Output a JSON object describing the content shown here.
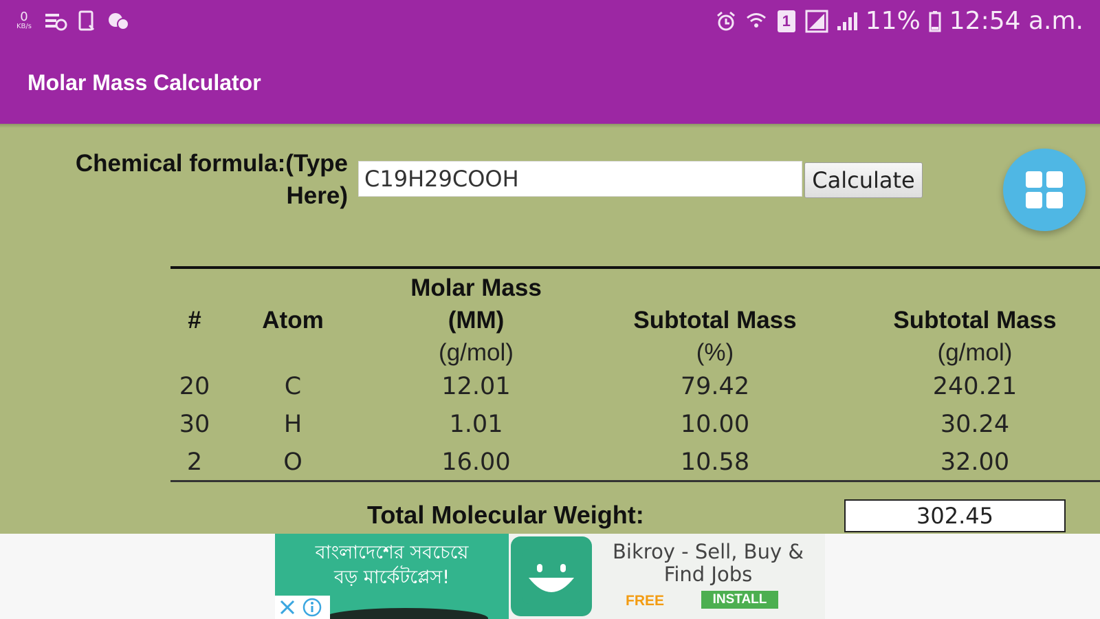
{
  "status_bar": {
    "battery": "11%",
    "time": "12:54 a.m.",
    "speed_value": "0",
    "speed_unit": "KB/s",
    "sim_label": "1"
  },
  "app_bar": {
    "title": "Molar Mass Calculator"
  },
  "form": {
    "label_line1": "Chemical formula:(Type",
    "label_line2": "Here)",
    "value": "C19H29COOH",
    "calculate_label": "Calculate"
  },
  "table": {
    "headers": {
      "count": "#",
      "atom": "Atom",
      "molar_mass_line1": "Molar Mass",
      "molar_mass_line2": "(MM)",
      "molar_mass_unit": "(g/mol)",
      "subtotal_pct": "Subtotal Mass",
      "subtotal_pct_unit": "(%)",
      "subtotal_gmol": "Subtotal Mass",
      "subtotal_gmol_unit": "(g/mol)"
    },
    "rows": [
      {
        "count": "20",
        "atom": "C",
        "mm": "12.01",
        "pct": "79.42",
        "gmol": "240.21"
      },
      {
        "count": "30",
        "atom": "H",
        "mm": "1.01",
        "pct": "10.00",
        "gmol": "30.24"
      },
      {
        "count": "2",
        "atom": "O",
        "mm": "16.00",
        "pct": "10.58",
        "gmol": "32.00"
      }
    ],
    "total_label": "Total Molecular Weight:",
    "total_value": "302.45"
  },
  "ad": {
    "bengali_line1": "বাংলাদেশের সবচেয়ে",
    "bengali_line2": "বড় মার্কেটপ্লেস!",
    "app_name": "Bikroy - Sell, Buy & Find Jobs",
    "free_label": "FREE",
    "install_label": "INSTALL"
  },
  "colors": {
    "primary": "#9c27a3",
    "background": "#adb87c",
    "fab": "#4fb7e4"
  },
  "icons": [
    "net-speed-icon",
    "data-saver-icon",
    "device-icon",
    "chat-icon",
    "alarm-icon",
    "wifi-icon",
    "sim-icon",
    "signal-icon",
    "battery-icon",
    "grid-icon",
    "ad-close-icon",
    "ad-info-icon",
    "ad-logo-icon"
  ]
}
